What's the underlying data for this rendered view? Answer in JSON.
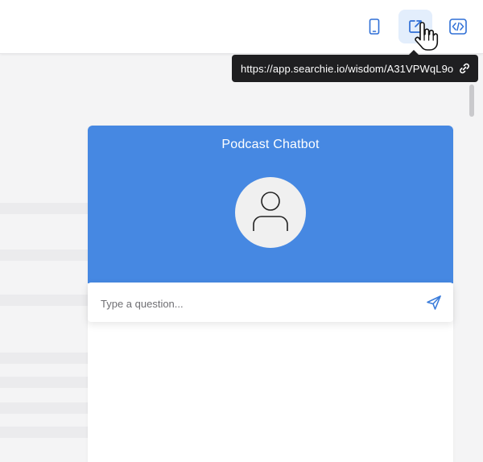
{
  "toolbar": {
    "buttons": [
      {
        "name": "mobile-preview",
        "icon": "mobile-phone-icon"
      },
      {
        "name": "open-external",
        "icon": "external-link-icon",
        "active": true
      },
      {
        "name": "embed-code",
        "icon": "code-embed-icon"
      }
    ],
    "accent_color": "#4688e2",
    "active_bg": "#e3eefc"
  },
  "tooltip": {
    "url": "https://app.searchie.io/wisdom/A31VPWqL9o",
    "icon": "link-icon"
  },
  "chatbot": {
    "title": "Podcast Chatbot",
    "header_color": "#4688e2",
    "avatar_icon": "user-icon",
    "input": {
      "placeholder": "Type a question...",
      "value": ""
    },
    "send_icon": "send-icon"
  }
}
